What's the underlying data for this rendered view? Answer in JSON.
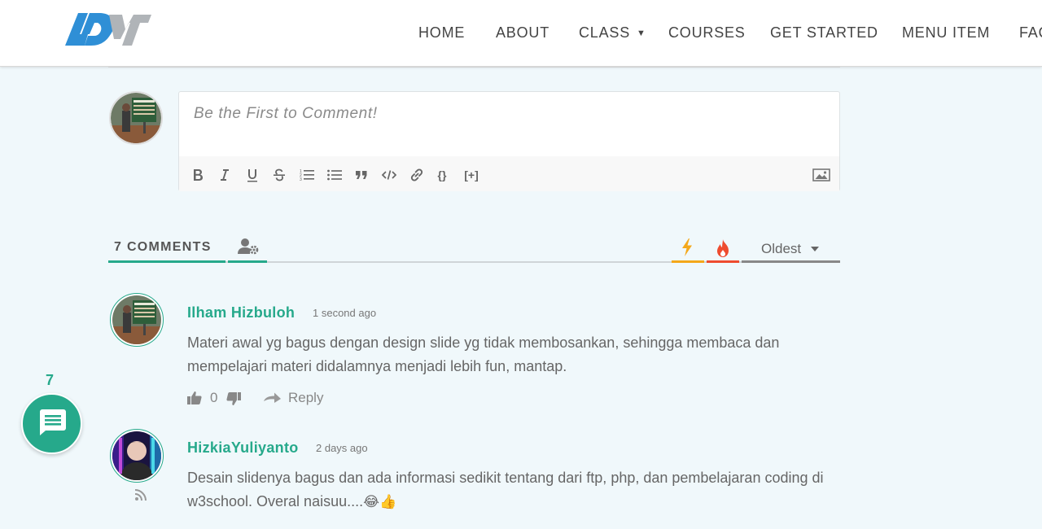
{
  "nav": {
    "items": [
      {
        "label": "HOME"
      },
      {
        "label": "ABOUT"
      },
      {
        "label": "CLASS",
        "has_dropdown": true
      },
      {
        "label": "COURSES"
      },
      {
        "label": "GET STARTED"
      },
      {
        "label": "MENU ITEM"
      },
      {
        "label": "FAQ"
      }
    ],
    "caret": "▼"
  },
  "comment_form": {
    "placeholder": "Be the First to Comment!",
    "toolbar_icons": [
      "bold-icon",
      "italic-icon",
      "underline-icon",
      "strikethrough-icon",
      "ordered-list-icon",
      "unordered-list-icon",
      "blockquote-icon",
      "code-icon",
      "link-icon",
      "code-block-icon",
      "spoiler-icon",
      "image-upload-icon"
    ],
    "toolbar_text": {
      "code_block": "{}",
      "spoiler": "[+]"
    }
  },
  "tabs": {
    "comments_count_label": "7 COMMENTS",
    "sort_label": "Oldest",
    "colors": {
      "accent": "#26a98b",
      "bolt": "#f4a81a",
      "fire": "#ee4c2f"
    }
  },
  "comments": [
    {
      "author": "Ilham Hizbuloh",
      "time": "1 second ago",
      "text": "Materi awal yg bagus dengan design slide yg tidak membosankan, sehingga membaca dan mempelajari materi didalamnya menjadi lebih fun, mantap.",
      "votes": "0",
      "reply_label": "Reply"
    },
    {
      "author": "HizkiaYuliyanto",
      "time": "2 days ago",
      "text": "Desain slidenya bagus dan ada informasi sedikit tentang dari ftp, php, dan pembelajaran coding di w3school. Overal naisuu....",
      "emoji": "😂👍"
    }
  ],
  "floating": {
    "count": "7"
  }
}
